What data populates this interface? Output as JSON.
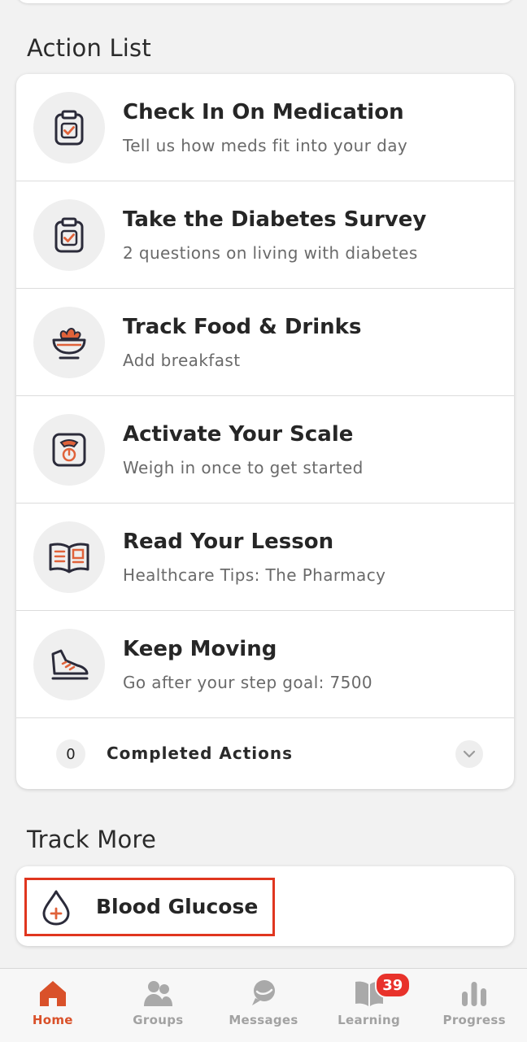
{
  "action_list": {
    "title": "Action List",
    "items": [
      {
        "icon": "clipboard-check-icon",
        "title": "Check In On Medication",
        "subtitle": "Tell us how meds fit into your day"
      },
      {
        "icon": "clipboard-check-icon",
        "title": "Take the Diabetes Survey",
        "subtitle": "2 questions on living with diabetes"
      },
      {
        "icon": "food-bowl-icon",
        "title": "Track Food & Drinks",
        "subtitle": "Add breakfast"
      },
      {
        "icon": "scale-icon",
        "title": "Activate Your Scale",
        "subtitle": "Weigh in once to get started"
      },
      {
        "icon": "open-book-icon",
        "title": "Read Your Lesson",
        "subtitle": "Healthcare Tips: The Pharmacy"
      },
      {
        "icon": "shoe-icon",
        "title": "Keep Moving",
        "subtitle": "Go after your step goal: 7500"
      }
    ],
    "completed": {
      "count": "0",
      "label": "Completed Actions"
    }
  },
  "track_more": {
    "title": "Track More",
    "item": {
      "icon": "blood-drop-icon",
      "label": "Blood Glucose"
    }
  },
  "tabbar": {
    "tabs": [
      {
        "label": "Home",
        "icon": "home-icon",
        "active": true
      },
      {
        "label": "Groups",
        "icon": "groups-icon"
      },
      {
        "label": "Messages",
        "icon": "messages-icon"
      },
      {
        "label": "Learning",
        "icon": "book-icon",
        "badge": "39"
      },
      {
        "label": "Progress",
        "icon": "bar-chart-icon"
      }
    ]
  },
  "colors": {
    "accent": "#e0623a",
    "icon_dark": "#2b2b3a",
    "highlight": "#e0361f",
    "badge": "#e8322b"
  }
}
